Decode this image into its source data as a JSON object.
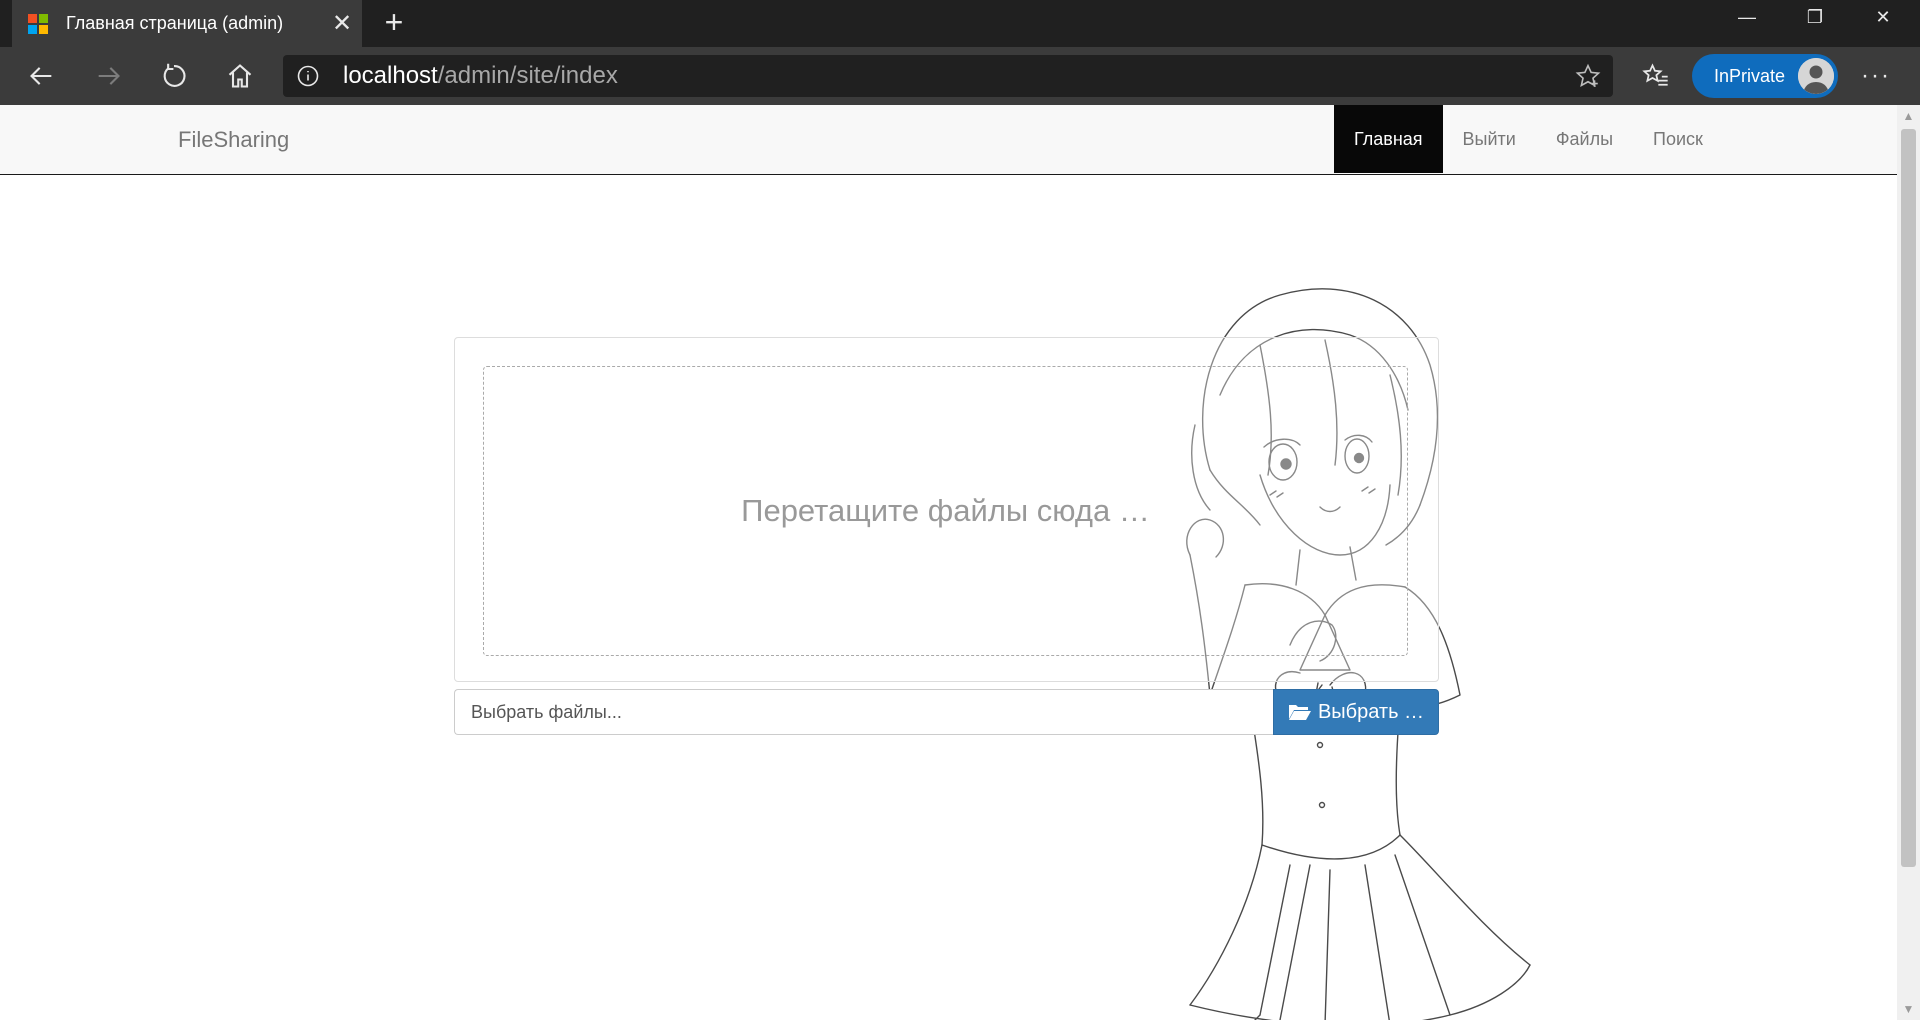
{
  "browser": {
    "tab_title": "Главная страница (admin)",
    "tab_close": "✕",
    "new_tab": "+",
    "url_host": "localhost",
    "url_path": "/admin/site/index",
    "inprivate_label": "InPrivate",
    "more": "···",
    "window_controls": {
      "minimize": "—",
      "maximize": "❐",
      "close": "✕"
    }
  },
  "site": {
    "brand": "FileSharing",
    "nav": [
      {
        "label": "Главная",
        "active": true
      },
      {
        "label": "Выйти",
        "active": false
      },
      {
        "label": "Файлы",
        "active": false
      },
      {
        "label": "Поиск",
        "active": false
      }
    ]
  },
  "upload": {
    "drop_text": "Перетащите файлы сюда …",
    "file_placeholder": "Выбрать файлы...",
    "browse_label": "Выбрать …"
  },
  "colors": {
    "browse_button": "#337ab7",
    "inprivate": "#0f6cbd",
    "nav_active_bg": "#080808",
    "navbar_bg": "#f8f8f8"
  },
  "icons": {
    "back": "back-arrow-icon",
    "forward": "forward-arrow-icon",
    "refresh": "refresh-icon",
    "home": "home-icon",
    "info": "info-icon",
    "favorite": "star-icon",
    "favorites": "favorites-icon",
    "folder": "folder-open-icon"
  }
}
